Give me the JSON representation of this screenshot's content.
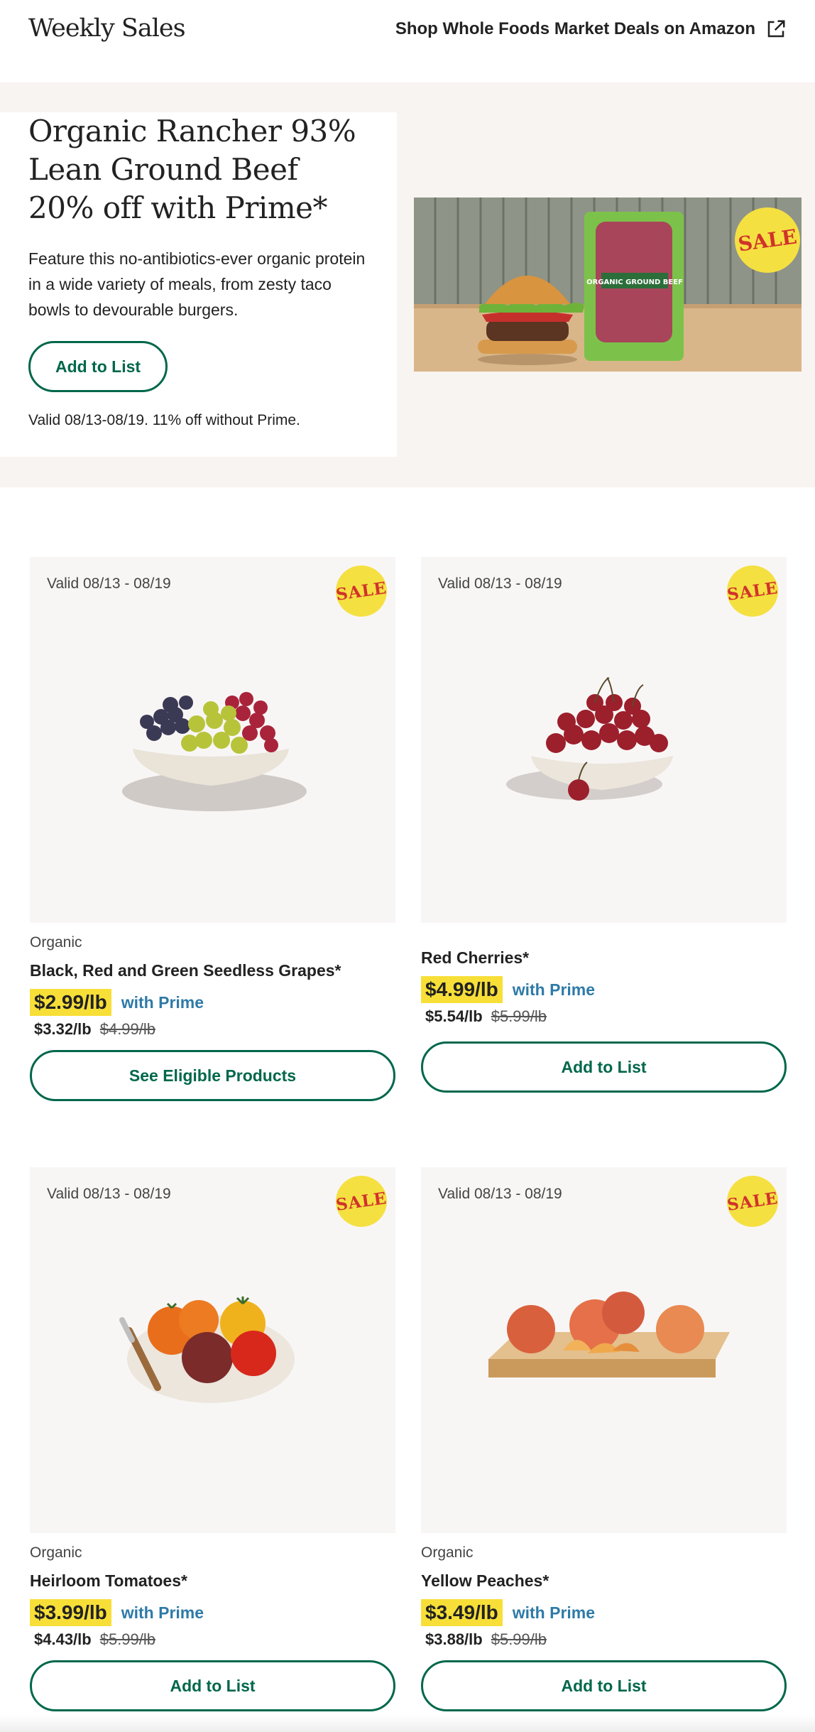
{
  "header": {
    "brand": "Weekly Sales",
    "shop_link": "Shop Whole Foods Market Deals on Amazon"
  },
  "hero": {
    "title": "Organic Rancher 93% Lean Ground Beef 20% off with Prime*",
    "description": "Feature this no-antibiotics-ever organic protein in a wide variety of meals, from zesty taco bowls to devourable burgers.",
    "button": "Add to List",
    "valid": "Valid 08/13-08/19. 11% off without Prime.",
    "image_badge": "SALE",
    "package_text": "ORGANIC GROUND BEEF"
  },
  "products": [
    {
      "valid": "Valid 08/13 - 08/19",
      "badge": "SALE",
      "subtitle": "Organic",
      "name": "Black, Red and Green Seedless Grapes*",
      "sale_price": "$2.99/lb",
      "prime": "with Prime",
      "reg_price": "$3.32/lb",
      "old_price": "$4.99/lb",
      "button": "See Eligible Products"
    },
    {
      "valid": "Valid 08/13 - 08/19",
      "badge": "SALE",
      "subtitle": "",
      "name": "Red Cherries*",
      "sale_price": "$4.99/lb",
      "prime": "with Prime",
      "reg_price": "$5.54/lb",
      "old_price": "$5.99/lb",
      "button": "Add to List"
    },
    {
      "valid": "Valid 08/13 - 08/19",
      "badge": "SALE",
      "subtitle": "Organic",
      "name": "Heirloom Tomatoes*",
      "sale_price": "$3.99/lb",
      "prime": "with Prime",
      "reg_price": "$4.43/lb",
      "old_price": "$5.99/lb",
      "button": "Add to List"
    },
    {
      "valid": "Valid 08/13 - 08/19",
      "badge": "SALE",
      "subtitle": "Organic",
      "name": "Yellow Peaches*",
      "sale_price": "$3.49/lb",
      "prime": "with Prime",
      "reg_price": "$3.88/lb",
      "old_price": "$5.99/lb",
      "button": "Add to List"
    }
  ],
  "colors": {
    "brand_green": "#00674b",
    "sale_yellow": "#f7df38",
    "prime_blue": "#2e7aa8",
    "hero_bg": "#f8f4f1"
  }
}
